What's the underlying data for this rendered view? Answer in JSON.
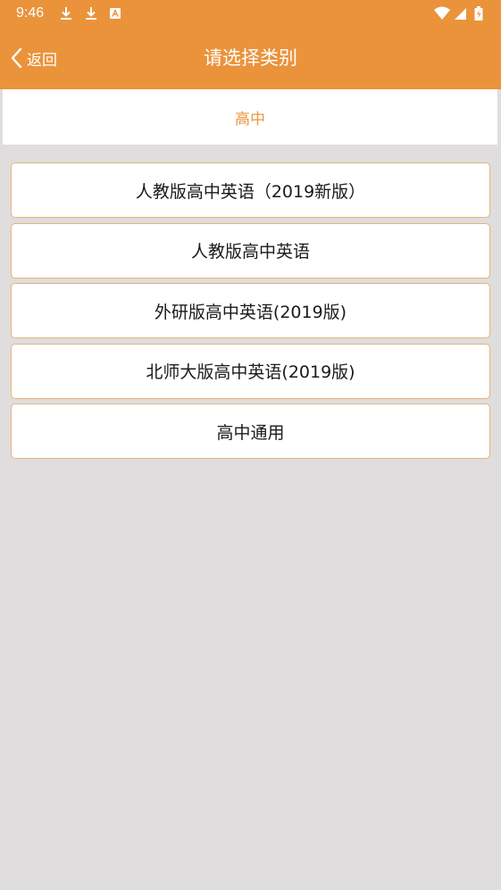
{
  "status_bar": {
    "time": "9:46",
    "left_icons": [
      "download-icon",
      "download-icon",
      "notification-a-icon"
    ],
    "right_icons": [
      "wifi-icon",
      "signal-icon",
      "battery-charging-icon"
    ]
  },
  "header": {
    "back_label": "返回",
    "title": "请选择类别"
  },
  "level_tab": {
    "label": "高中"
  },
  "categories": [
    {
      "label": "人教版高中英语（2019新版）"
    },
    {
      "label": "人教版高中英语"
    },
    {
      "label": "外研版高中英语(2019版)"
    },
    {
      "label": "北师大版高中英语(2019版)"
    },
    {
      "label": "高中通用"
    }
  ],
  "colors": {
    "header_bg": "#ea933b",
    "accent_text": "#e8963f",
    "item_border": "#e6b57a",
    "page_bg": "#dfdddd"
  }
}
